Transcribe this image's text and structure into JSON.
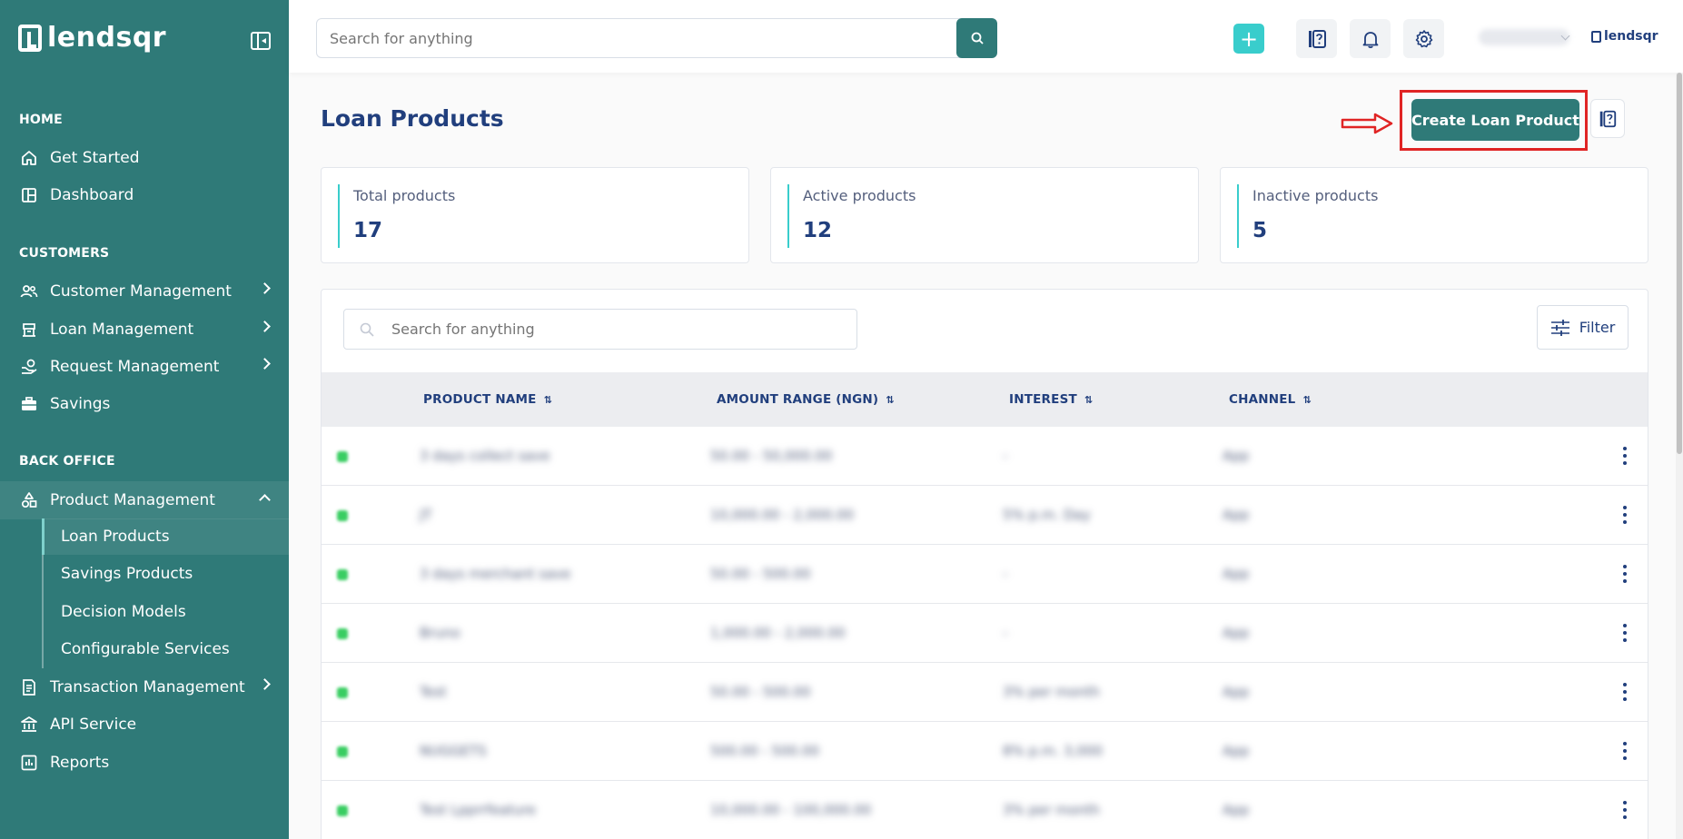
{
  "brand": {
    "name": "lendsqr",
    "small_name": "lendsqr"
  },
  "sidebar": {
    "sections": {
      "home": "HOME",
      "customers": "CUSTOMERS",
      "back_office": "BACK OFFICE"
    },
    "items": {
      "get_started": "Get Started",
      "dashboard": "Dashboard",
      "customer_management": "Customer Management",
      "loan_management": "Loan Management",
      "request_management": "Request Management",
      "savings": "Savings",
      "product_management": "Product Management",
      "transaction_management": "Transaction Management",
      "api_service": "API Service",
      "reports": "Reports"
    },
    "sub_items": {
      "loan_products": "Loan Products",
      "savings_products": "Savings Products",
      "decision_models": "Decision Models",
      "configurable_services": "Configurable Services"
    }
  },
  "topbar": {
    "search_placeholder": "Search for anything",
    "plus_label": "+"
  },
  "page": {
    "title": "Loan Products",
    "create_button": "Create Loan Product"
  },
  "stats": [
    {
      "label": "Total products",
      "value": "17"
    },
    {
      "label": "Active products",
      "value": "12"
    },
    {
      "label": "Inactive products",
      "value": "5"
    }
  ],
  "table": {
    "search_placeholder": "Search for anything",
    "filter_label": "Filter",
    "columns": [
      "PRODUCT NAME",
      "AMOUNT RANGE (NGN)",
      "INTEREST",
      "CHANNEL"
    ],
    "rows": [
      [
        "3 days collect save",
        "50.00 - 50,000.00",
        "-",
        "App"
      ],
      [
        "JT",
        "10,000.00 - 2,000.00",
        "5% p.m. Day",
        "App"
      ],
      [
        "3 days merchant save",
        "50.00 - 500.00",
        "-",
        "App"
      ],
      [
        "Bruno",
        "1,000.00 - 2,000.00",
        "-",
        "App"
      ],
      [
        "Test",
        "50.00 - 500.00",
        "3% per month",
        "App"
      ],
      [
        "NUGGETS",
        "500.00 - 500.00",
        "8% p.m. 3,000",
        "App"
      ],
      [
        "Test Lpprrfeature",
        "10,000.00 - 100,000.00",
        "3% per month",
        "App"
      ]
    ]
  },
  "colors": {
    "sidebar": "#2f7a78",
    "accent": "#39cdcc",
    "primary_text": "#213f7d",
    "highlight": "#e02424"
  }
}
